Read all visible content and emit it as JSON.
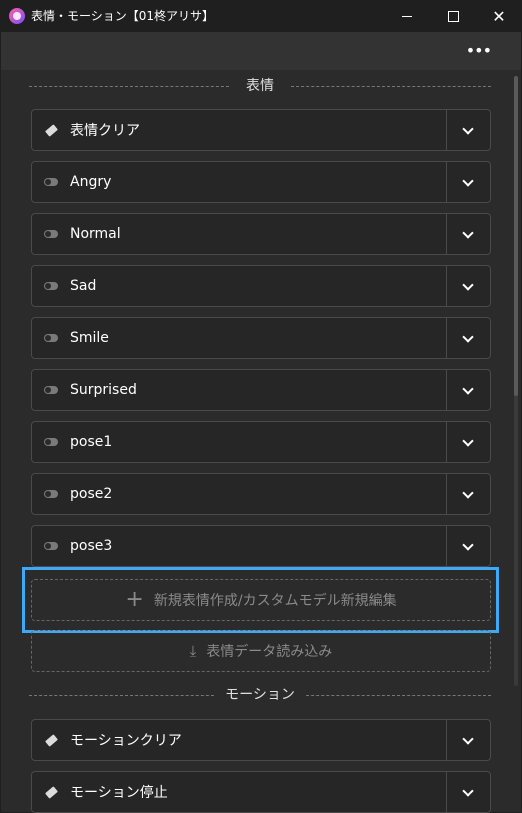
{
  "window": {
    "title": "表情・モーション【01柊アリサ】",
    "minimize": "—",
    "maximize": "☐",
    "close": "✕"
  },
  "toolbar": {
    "more": "•••"
  },
  "expressions": {
    "heading": "表情",
    "clear_label": "表情クリア",
    "items": [
      {
        "label": "Angry"
      },
      {
        "label": "Normal"
      },
      {
        "label": "Sad"
      },
      {
        "label": "Smile"
      },
      {
        "label": "Surprised"
      },
      {
        "label": "pose1"
      },
      {
        "label": "pose2"
      },
      {
        "label": "pose3"
      }
    ],
    "new_button": "新規表情作成/カスタムモデル新規編集",
    "load_button": "表情データ読み込み"
  },
  "motions": {
    "heading": "モーション",
    "clear_label": "モーションクリア",
    "stop_label": "モーション停止"
  },
  "colors": {
    "highlight": "#3fa9f5",
    "panel_bg": "#2b2b2b"
  }
}
